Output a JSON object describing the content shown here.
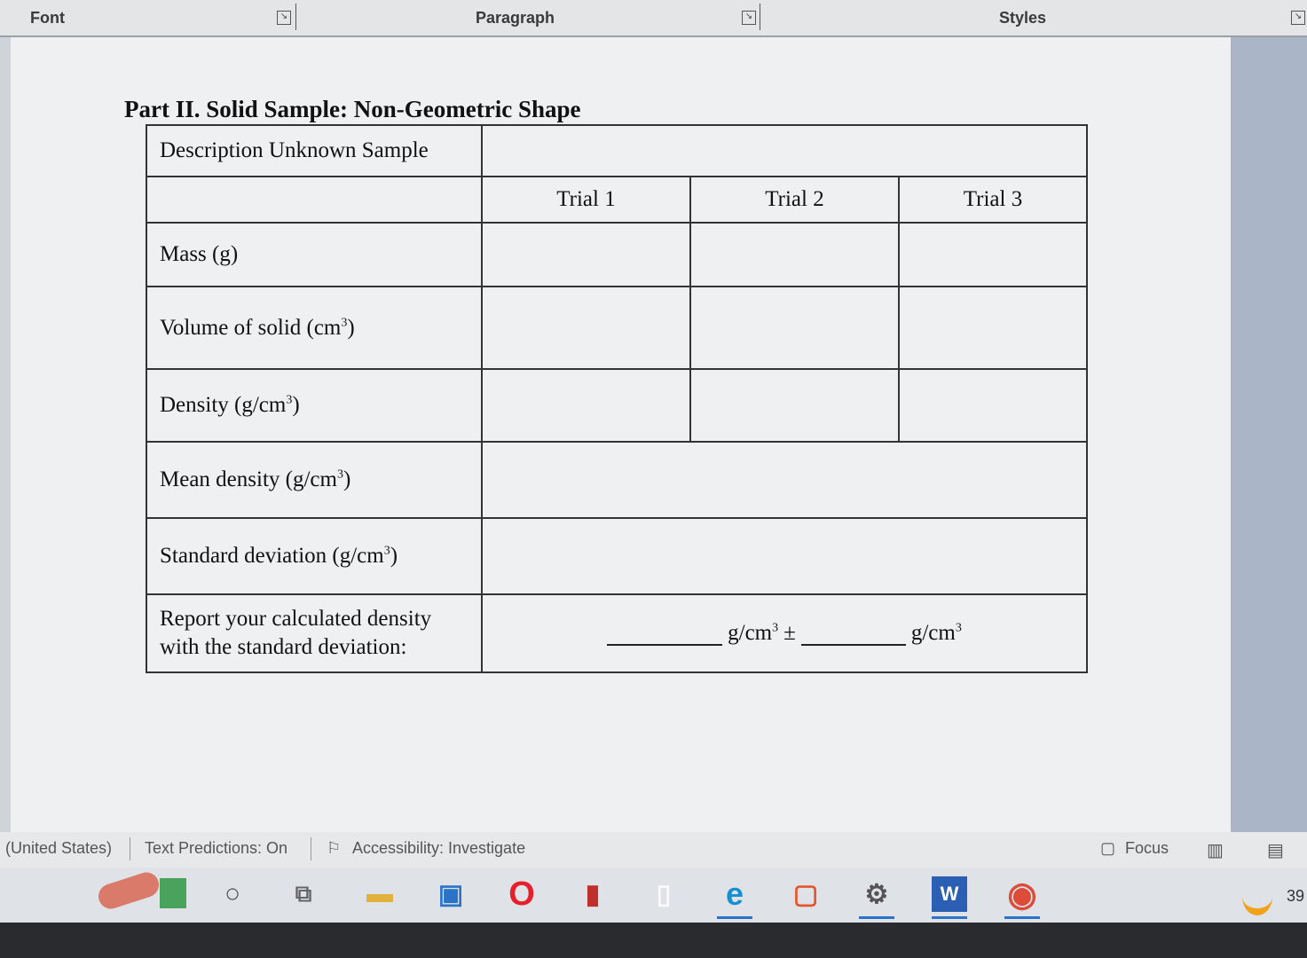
{
  "ribbon": {
    "groups": [
      {
        "label": "Font"
      },
      {
        "label": "Paragraph"
      },
      {
        "label": "Styles"
      }
    ],
    "launcher_icon": "dialog-launcher-icon"
  },
  "document": {
    "title": "Part II. Solid Sample: Non-Geometric Shape",
    "table": {
      "description_label": "Description Unknown Sample",
      "columns": [
        "Trial 1",
        "Trial 2",
        "Trial 3"
      ],
      "rows": {
        "mass": "Mass (g)",
        "volume": "Volume of solid (cm",
        "density": "Density (g/cm",
        "mean_density": "Mean density (g/cm",
        "std_dev": "Standard deviation (g/cm",
        "close": ")",
        "superscript": "3"
      },
      "report": {
        "line1": "Report your calculated density",
        "line2": "with the standard deviation:",
        "unit_a": "g/cm",
        "plus_minus": "±",
        "unit_b": "g/cm",
        "superscript": "3"
      }
    }
  },
  "status_bar": {
    "language": "(United States)",
    "text_predictions": "Text Predictions: On",
    "accessibility": "Accessibility: Investigate",
    "focus": "Focus"
  },
  "taskbar": {
    "items": [
      {
        "icon": "start-circle-icon"
      },
      {
        "icon": "task-view-icon"
      },
      {
        "icon": "file-explorer-icon"
      },
      {
        "icon": "store-icon"
      },
      {
        "icon": "opera-icon"
      },
      {
        "icon": "office-app-icon"
      },
      {
        "icon": "blank-file-icon"
      },
      {
        "icon": "edge-icon"
      },
      {
        "icon": "office-icon"
      },
      {
        "icon": "settings-icon"
      },
      {
        "icon": "word-icon"
      },
      {
        "icon": "chrome-icon"
      }
    ],
    "clock_partial": "39"
  },
  "colors": {
    "ribbon_bg": "#e3e5e7",
    "page_bg": "#eef0f1",
    "taskbar_bg": "#dfe3e8",
    "accent": "#2a73c9"
  }
}
